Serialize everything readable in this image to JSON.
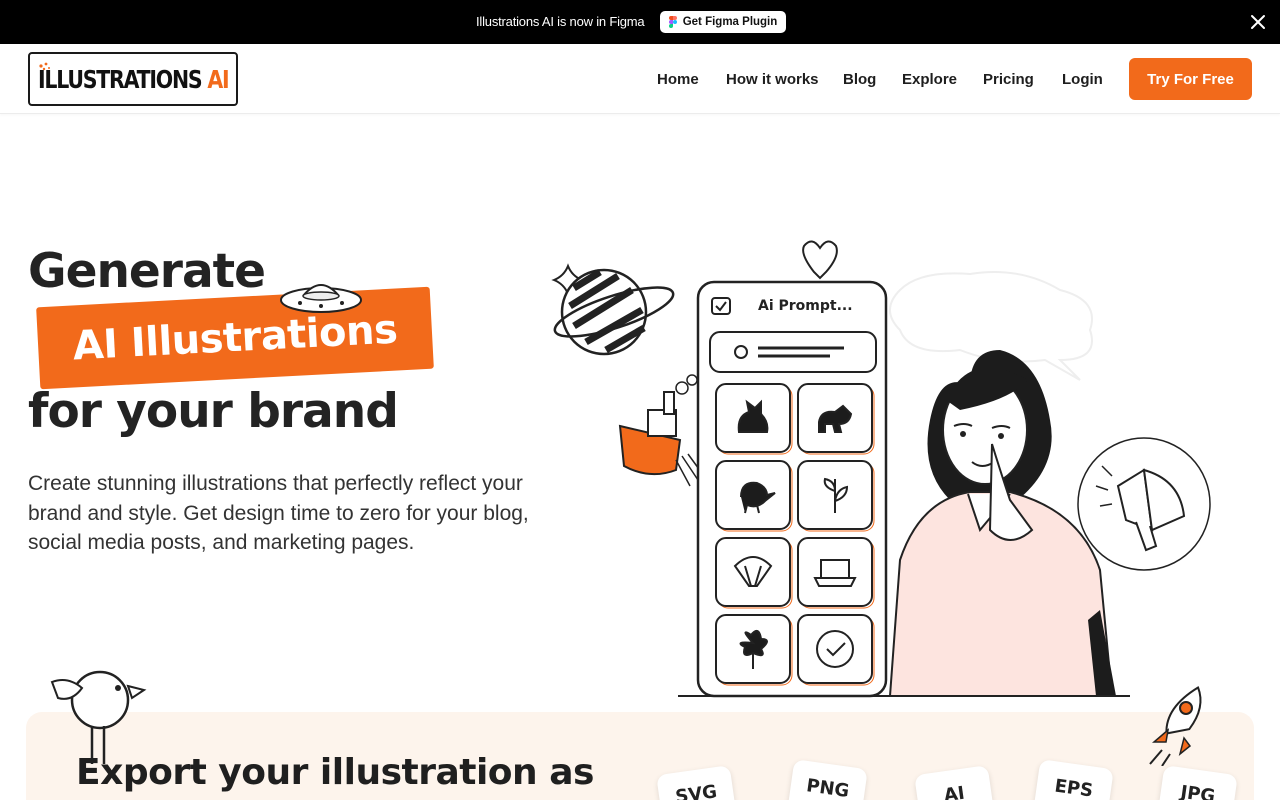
{
  "announcement": {
    "message": "Illustrations AI is now in Figma",
    "button_label": "Get Figma Plugin"
  },
  "brand": {
    "logo_main": "ILLUSTRATIONS",
    "logo_accent": "AI",
    "accent_color": "#f26a1b"
  },
  "nav": {
    "links": [
      "Home",
      "How it works",
      "Blog",
      "Explore",
      "Pricing",
      "Login"
    ],
    "cta_label": "Try For Free"
  },
  "hero": {
    "line1": "Generate",
    "highlight": "AI Illustrations",
    "line3": "for your brand",
    "subtitle": "Create stunning illustrations that perfectly reflect your brand and style. Get design time to zero for your blog, social media posts, and marketing pages."
  },
  "phone_mock": {
    "title": "Ai Prompt...",
    "tiles": [
      "cat-icon",
      "dog-icon",
      "bird-icon",
      "plant-icon",
      "parachute-icon",
      "laptop-icon",
      "flower-icon",
      "checkmark-icon"
    ]
  },
  "export": {
    "title": "Export your illustration as",
    "formats": [
      "SVG",
      "PNG",
      "AI",
      "EPS",
      "JPG"
    ]
  }
}
